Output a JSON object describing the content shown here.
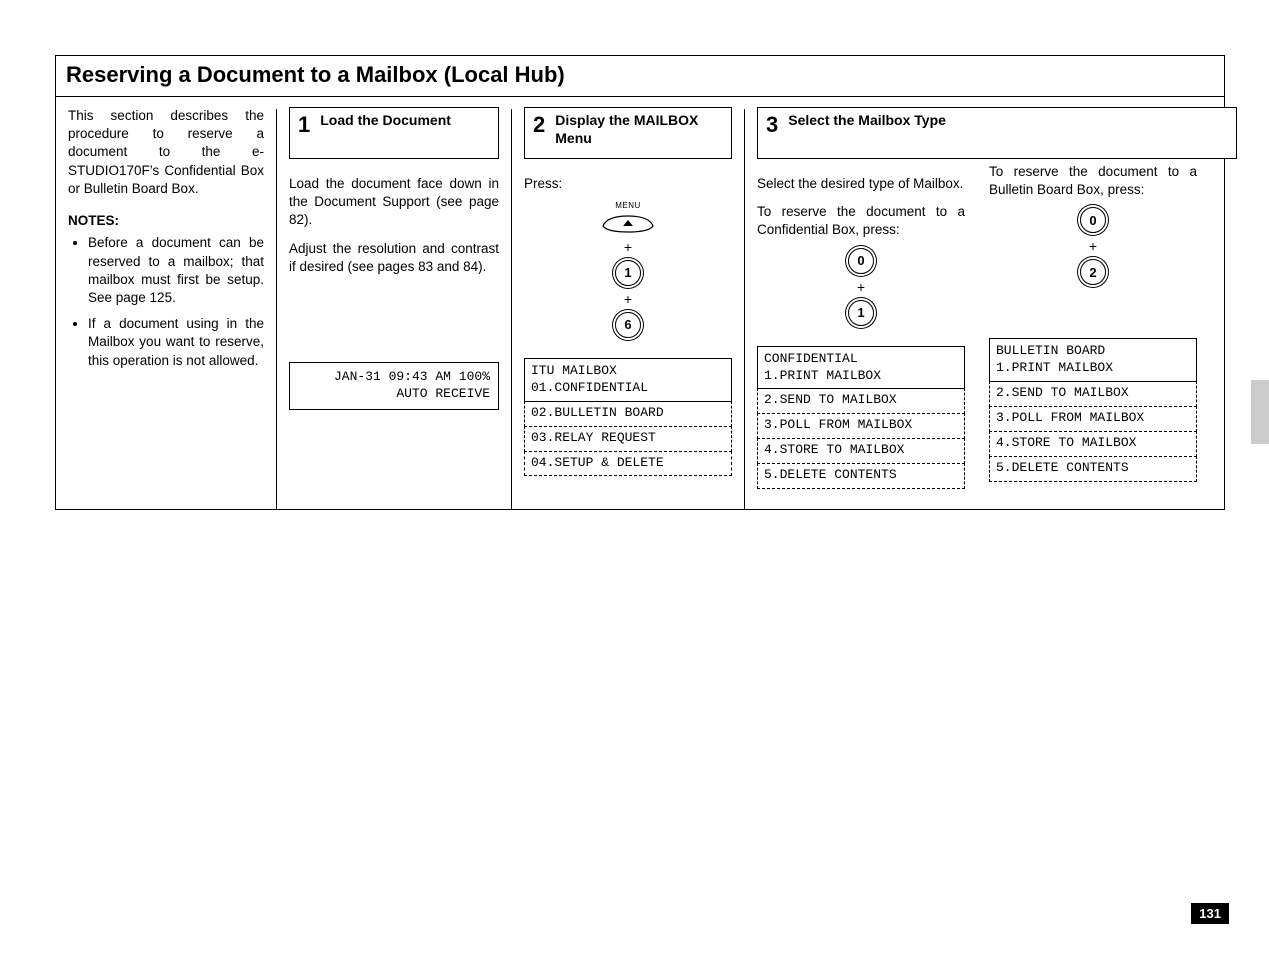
{
  "page": {
    "title": "Reserving a Document to a Mailbox (Local Hub)",
    "number": "131"
  },
  "intro": {
    "body": "This section describes the procedure to reserve a document to the e-STUDIO170F’s Confidential Box or Bulletin Board Box.",
    "notes_heading": "NOTES:",
    "notes": [
      "Before a document can be reserved to a mailbox; that mailbox must first be setup. See page 125.",
      "If a document using in the Mailbox you want to reserve, this operation is not allowed."
    ]
  },
  "step1": {
    "num": "1",
    "title": "Load the Document",
    "body1": "Load the document face down in the Document Support (see page 82).",
    "body2": "Adjust the resolution and contrast if desired (see pages 83 and 84).",
    "lcd": "JAN-31 09:43 AM 100%\n        AUTO RECEIVE"
  },
  "step2": {
    "num": "2",
    "title": "Display the MAILBOX Menu",
    "press": "Press:",
    "menu_label": "MENU",
    "key_a": "1",
    "key_b": "6",
    "lcd_first": "ITU MAILBOX\n01.CONFIDENTIAL",
    "lcd_rows": [
      "02.BULLETIN BOARD",
      "03.RELAY REQUEST",
      "04.SETUP & DELETE"
    ]
  },
  "step3": {
    "num": "3",
    "title": "Select the Mailbox Type",
    "left": {
      "line1": "Select the desired type of Mailbox.",
      "line2": "To reserve the document to a Confidential Box, press:",
      "key_a": "0",
      "key_b": "1",
      "lcd_first": "CONFIDENTIAL\n1.PRINT MAILBOX",
      "lcd_rows": [
        "2.SEND TO MAILBOX",
        "3.POLL FROM MAILBOX",
        "4.STORE TO MAILBOX",
        "5.DELETE CONTENTS"
      ]
    },
    "right": {
      "line1": "To reserve the document to a Bulletin Board Box, press:",
      "key_a": "0",
      "key_b": "2",
      "lcd_first": "BULLETIN BOARD\n1.PRINT MAILBOX",
      "lcd_rows": [
        "2.SEND TO MAILBOX",
        "3.POLL FROM MAILBOX",
        "4.STORE TO MAILBOX",
        "5.DELETE CONTENTS"
      ]
    }
  }
}
